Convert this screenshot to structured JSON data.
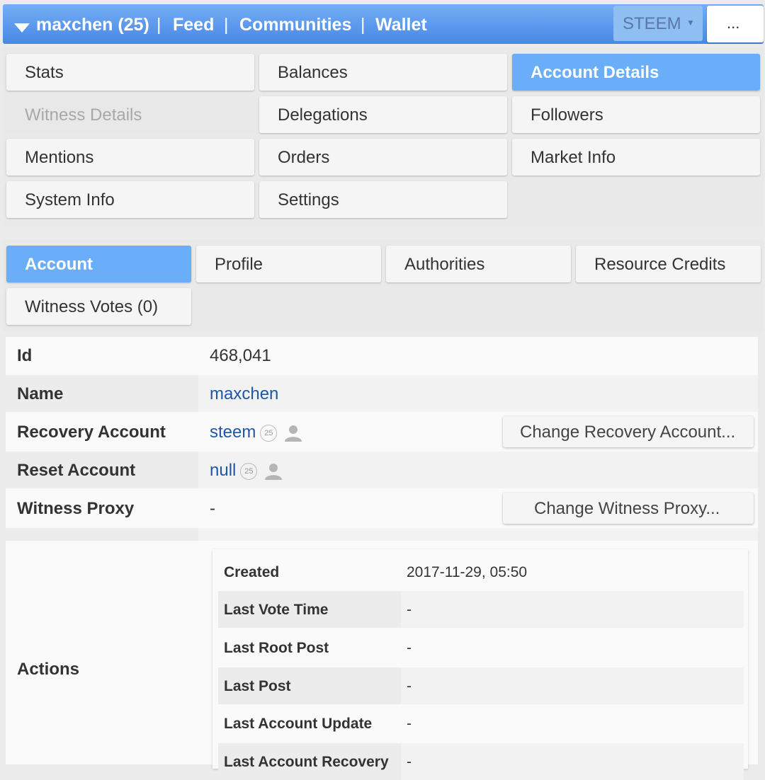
{
  "topbar": {
    "account": "maxchen (25)",
    "nav": [
      "Feed",
      "Communities",
      "Wallet"
    ],
    "separator": "|",
    "chain_select": "STEEM",
    "more": "..."
  },
  "menu": {
    "items": [
      {
        "label": "Stats",
        "state": "normal"
      },
      {
        "label": "Balances",
        "state": "normal"
      },
      {
        "label": "Account Details",
        "state": "active"
      },
      {
        "label": "Witness Details",
        "state": "disabled"
      },
      {
        "label": "Delegations",
        "state": "normal"
      },
      {
        "label": "Followers",
        "state": "normal"
      },
      {
        "label": "Mentions",
        "state": "normal"
      },
      {
        "label": "Orders",
        "state": "normal"
      },
      {
        "label": "Market Info",
        "state": "normal"
      },
      {
        "label": "System Info",
        "state": "normal"
      },
      {
        "label": "Settings",
        "state": "normal"
      }
    ]
  },
  "tabs": {
    "items": [
      {
        "label": "Account",
        "state": "active"
      },
      {
        "label": "Profile",
        "state": "normal"
      },
      {
        "label": "Authorities",
        "state": "normal"
      },
      {
        "label": "Resource Credits",
        "state": "normal"
      },
      {
        "label": "Witness Votes (0)",
        "state": "normal"
      }
    ]
  },
  "details": {
    "id": {
      "key": "Id",
      "value": "468,041"
    },
    "name": {
      "key": "Name",
      "value": "maxchen"
    },
    "recovery": {
      "key": "Recovery Account",
      "value": "steem",
      "rep": "25",
      "button": "Change Recovery Account..."
    },
    "reset": {
      "key": "Reset Account",
      "value": "null",
      "rep": "25"
    },
    "proxy": {
      "key": "Witness Proxy",
      "value": "-",
      "button": "Change Witness Proxy..."
    },
    "actions_key": "Actions"
  },
  "actions": [
    {
      "key": "Created",
      "value": "2017-11-29, 05:50"
    },
    {
      "key": "Last Vote Time",
      "value": "-"
    },
    {
      "key": "Last Root Post",
      "value": "-"
    },
    {
      "key": "Last Post",
      "value": "-"
    },
    {
      "key": "Last Account Update",
      "value": "-"
    },
    {
      "key": "Last Account Recovery",
      "value": "-"
    }
  ],
  "colors": {
    "accent": "#6aaefa",
    "topbar": "#4a87e6",
    "link": "#1f56a6"
  },
  "icons": {
    "menu_toggle": "triangle-down-icon",
    "user": "person-icon",
    "select_arrow": "caret-down-icon"
  }
}
